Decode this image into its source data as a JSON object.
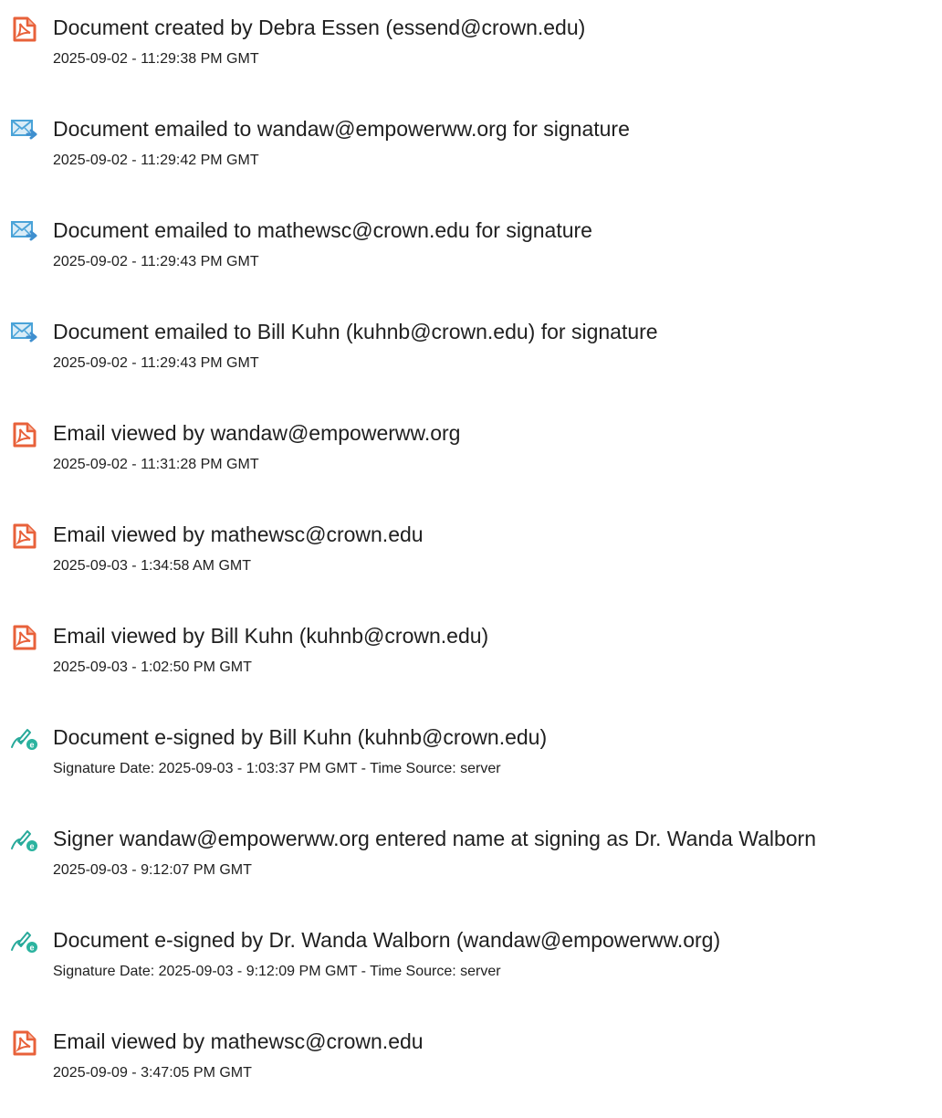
{
  "events": [
    {
      "icon": "document-icon",
      "title": "Document created by Debra Essen (essend@crown.edu)",
      "meta": "2025-09-02 - 11:29:38 PM GMT"
    },
    {
      "icon": "email-sent-icon",
      "title": "Document emailed to wandaw@empowerww.org for signature",
      "meta": "2025-09-02 - 11:29:42 PM GMT"
    },
    {
      "icon": "email-sent-icon",
      "title": "Document emailed to mathewsc@crown.edu for signature",
      "meta": "2025-09-02 - 11:29:43 PM GMT"
    },
    {
      "icon": "email-sent-icon",
      "title": "Document emailed to Bill Kuhn (kuhnb@crown.edu) for signature",
      "meta": "2025-09-02 - 11:29:43 PM GMT"
    },
    {
      "icon": "document-icon",
      "title": "Email viewed by wandaw@empowerww.org",
      "meta": "2025-09-02 - 11:31:28 PM GMT"
    },
    {
      "icon": "document-icon",
      "title": "Email viewed by mathewsc@crown.edu",
      "meta": "2025-09-03 - 1:34:58 AM GMT"
    },
    {
      "icon": "document-icon",
      "title": "Email viewed by Bill Kuhn (kuhnb@crown.edu)",
      "meta": "2025-09-03 - 1:02:50 PM GMT"
    },
    {
      "icon": "esign-icon",
      "title": "Document e-signed by Bill Kuhn (kuhnb@crown.edu)",
      "meta": "Signature Date: 2025-09-03 - 1:03:37 PM GMT - Time Source: server"
    },
    {
      "icon": "esign-icon",
      "title": "Signer wandaw@empowerww.org entered name at signing as Dr. Wanda Walborn",
      "meta": "2025-09-03 - 9:12:07 PM GMT"
    },
    {
      "icon": "esign-icon",
      "title": "Document e-signed by Dr. Wanda Walborn (wandaw@empowerww.org)",
      "meta": "Signature Date: 2025-09-03 - 9:12:09 PM GMT - Time Source: server"
    },
    {
      "icon": "document-icon",
      "title": "Email viewed by mathewsc@crown.edu",
      "meta": "2025-09-09 - 3:47:05 PM GMT"
    }
  ]
}
